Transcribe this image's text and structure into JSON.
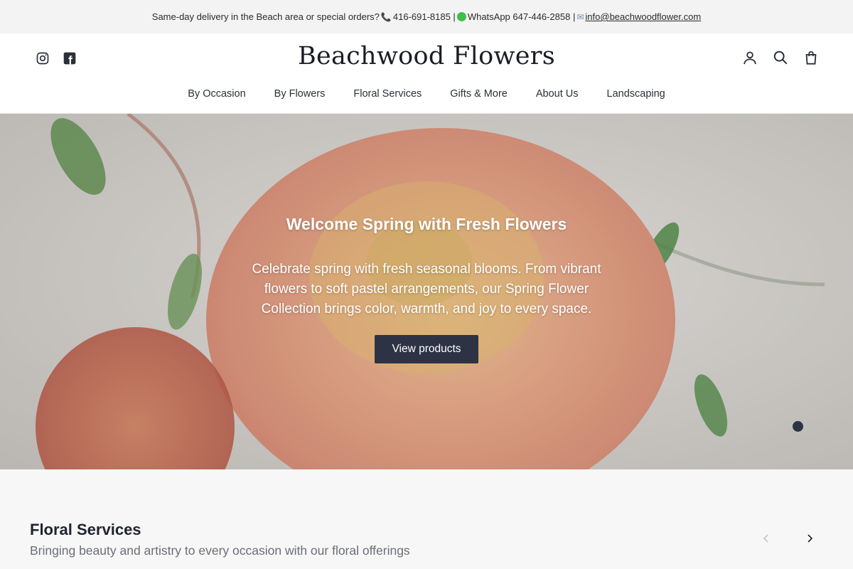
{
  "announcement": {
    "text_before": "Same-day delivery in the Beach area or special orders?",
    "phone_icon": "phone-icon",
    "phone": "416-691-8185 |",
    "whatsapp_icon": "whatsapp-dot-icon",
    "whatsapp": "WhatsApp 647-446-2858 |",
    "mail_icon": "mail-icon",
    "email": "info@beachwoodflower.com"
  },
  "header": {
    "logo": "Beachwood Flowers",
    "social": [
      "instagram-icon",
      "facebook-icon"
    ],
    "utility": [
      "account-icon",
      "search-icon",
      "cart-icon"
    ]
  },
  "nav": {
    "items": [
      "By Occasion",
      "By Flowers",
      "Floral Services",
      "Gifts & More",
      "About Us",
      "Landscaping"
    ]
  },
  "hero": {
    "title": "Welcome Spring with Fresh Flowers",
    "text": "Celebrate spring with fresh seasonal blooms. From vibrant flowers to soft pastel arrangements, our Spring Flower Collection brings color, warmth, and joy to every space.",
    "button": "View products"
  },
  "section": {
    "title": "Floral Services",
    "subtitle": "Bringing beauty and artistry to every occasion with our floral offerings",
    "prev_icon": "chevron-left-icon",
    "next_icon": "chevron-right-icon"
  },
  "colors": {
    "accent": "#2d3344",
    "announcement_bg": "#f3f3f3",
    "section_bg": "#f7f7f7"
  }
}
